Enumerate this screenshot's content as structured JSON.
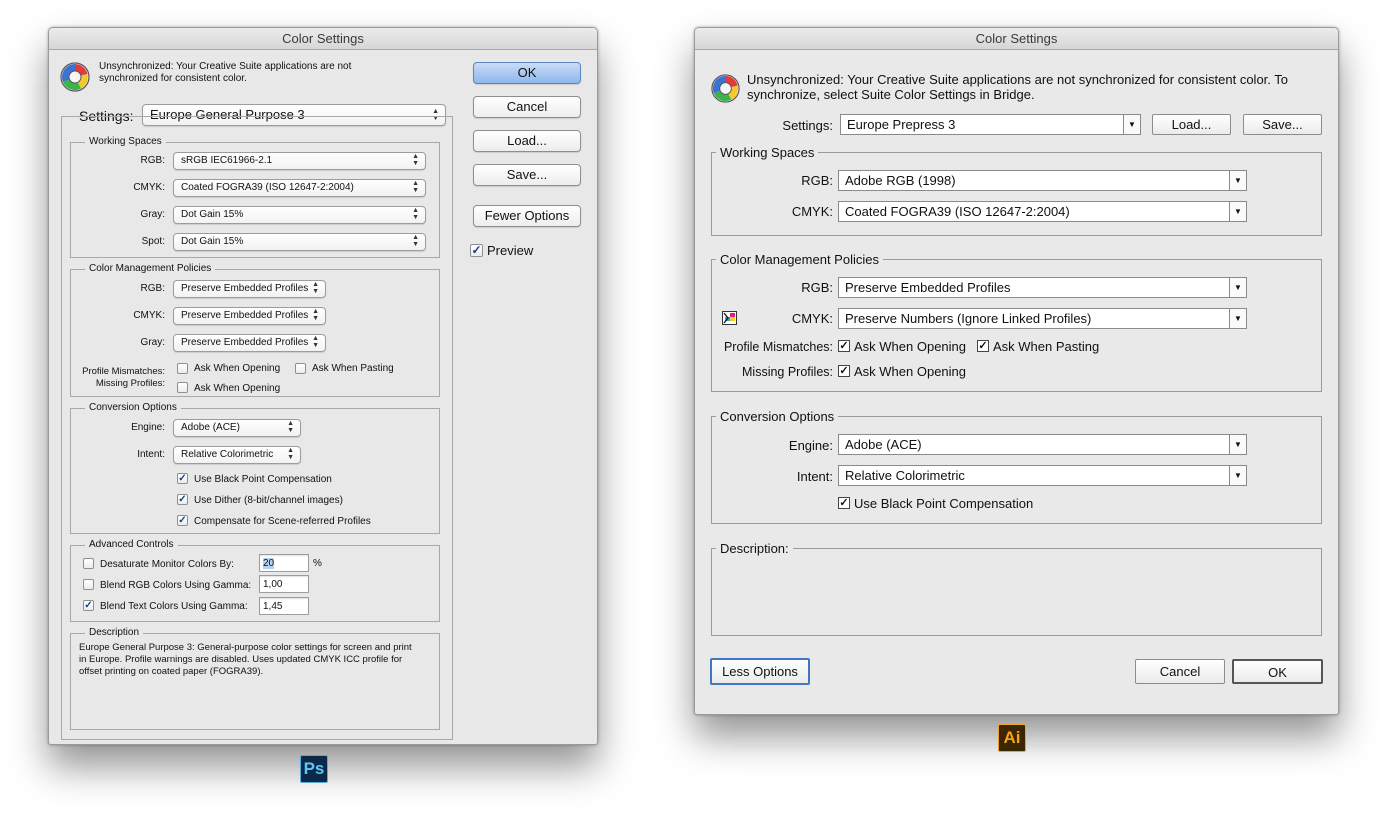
{
  "ps": {
    "title": "Color Settings",
    "sync_line1": "Unsynchronized: Your Creative Suite applications are not",
    "sync_line2": "synchronized for consistent color.",
    "settings_label": "Settings:",
    "settings_value": "Europe General Purpose 3",
    "buttons": {
      "ok": "OK",
      "cancel": "Cancel",
      "load": "Load...",
      "save": "Save...",
      "fewer": "Fewer Options",
      "preview": "Preview"
    },
    "working_spaces": {
      "legend": "Working Spaces",
      "rgb_label": "RGB:",
      "rgb_value": "sRGB IEC61966-2.1",
      "cmyk_label": "CMYK:",
      "cmyk_value": "Coated FOGRA39 (ISO 12647-2:2004)",
      "gray_label": "Gray:",
      "gray_value": "Dot Gain 15%",
      "spot_label": "Spot:",
      "spot_value": "Dot Gain 15%"
    },
    "policies": {
      "legend": "Color Management Policies",
      "rgb_label": "RGB:",
      "rgb_value": "Preserve Embedded Profiles",
      "cmyk_label": "CMYK:",
      "cmyk_value": "Preserve Embedded Profiles",
      "gray_label": "Gray:",
      "gray_value": "Preserve Embedded Profiles",
      "mismatch_label": "Profile Mismatches:",
      "missing_label": "Missing Profiles:",
      "ask_opening": "Ask When Opening",
      "ask_pasting": "Ask When Pasting",
      "missing_ask": "Ask When Opening"
    },
    "conversion": {
      "legend": "Conversion Options",
      "engine_label": "Engine:",
      "engine_value": "Adobe (ACE)",
      "intent_label": "Intent:",
      "intent_value": "Relative Colorimetric",
      "bpc": "Use Black Point Compensation",
      "dither": "Use Dither (8-bit/channel images)",
      "scene": "Compensate for Scene-referred Profiles"
    },
    "advanced": {
      "legend": "Advanced Controls",
      "desat_label": "Desaturate Monitor Colors By:",
      "desat_value": "20",
      "desat_unit": "%",
      "blend_rgb_label": "Blend RGB Colors Using Gamma:",
      "blend_rgb_value": "1,00",
      "blend_text_label": "Blend Text Colors Using Gamma:",
      "blend_text_value": "1,45"
    },
    "description": {
      "legend": "Description",
      "line1": "Europe General Purpose 3:  General-purpose color settings for screen and print",
      "line2": "in Europe. Profile warnings are disabled. Uses updated CMYK ICC profile for",
      "line3": "offset printing on coated paper (FOGRA39)."
    },
    "badge": "Ps"
  },
  "ai": {
    "title": "Color Settings",
    "sync_line1": "Unsynchronized: Your Creative Suite applications are not synchronized for consistent color. To",
    "sync_line2": "synchronize, select Suite Color Settings in Bridge.",
    "settings_label": "Settings:",
    "settings_value": "Europe Prepress 3",
    "load": "Load...",
    "save": "Save...",
    "working_spaces": {
      "legend": "Working Spaces",
      "rgb_label": "RGB:",
      "rgb_value": "Adobe RGB (1998)",
      "cmyk_label": "CMYK:",
      "cmyk_value": "Coated FOGRA39 (ISO 12647-2:2004)"
    },
    "policies": {
      "legend": "Color Management Policies",
      "rgb_label": "RGB:",
      "rgb_value": "Preserve Embedded Profiles",
      "cmyk_label": "CMYK:",
      "cmyk_value": "Preserve Numbers (Ignore Linked Profiles)",
      "mismatch_label": "Profile Mismatches:",
      "ask_opening": "Ask When Opening",
      "ask_pasting": "Ask When Pasting",
      "missing_label": "Missing Profiles:",
      "missing_ask": "Ask When Opening"
    },
    "conversion": {
      "legend": "Conversion Options",
      "engine_label": "Engine:",
      "engine_value": "Adobe (ACE)",
      "intent_label": "Intent:",
      "intent_value": "Relative Colorimetric",
      "bpc": "Use Black Point Compensation"
    },
    "description": {
      "legend": "Description:"
    },
    "less_options": "Less Options",
    "cancel": "Cancel",
    "ok": "OK",
    "badge": "Ai"
  }
}
